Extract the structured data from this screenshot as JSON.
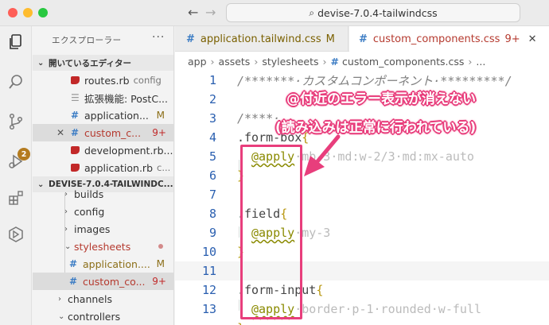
{
  "window": {
    "search_text": "devise-7.0.4-tailwindcss"
  },
  "activity": {
    "scm_badge": "2"
  },
  "sidebar": {
    "title": "エクスプローラー",
    "more": "···",
    "open_editors_label": "開いているエディター",
    "open_editors": [
      {
        "name": "routes.rb",
        "detail": "config",
        "icon": "ruby"
      },
      {
        "name": "拡張機能: PostC...",
        "detail": "",
        "icon": "doc"
      },
      {
        "name": "application...",
        "status": "M",
        "icon": "css"
      },
      {
        "name": "custom_c...",
        "status": "9+",
        "icon": "css",
        "close": "✕"
      },
      {
        "name": "development.rb...",
        "detail": "",
        "icon": "ruby"
      },
      {
        "name": "application.rb",
        "detail": "c...",
        "icon": "ruby"
      }
    ],
    "project_label": "DEVISE-7.0.4-TAILWINDC...",
    "tree": [
      {
        "name": "builds"
      },
      {
        "name": "config"
      },
      {
        "name": "images"
      },
      {
        "name": "stylesheets"
      },
      {
        "name": "application....",
        "status": "M"
      },
      {
        "name": "custom_co...",
        "status": "9+"
      },
      {
        "name": "channels"
      },
      {
        "name": "controllers"
      }
    ]
  },
  "tabs": [
    {
      "label": "application.tailwind.css",
      "status": "M"
    },
    {
      "label": "custom_components.css",
      "status": "9+",
      "close": "✕"
    }
  ],
  "breadcrumb": {
    "parts": [
      "app",
      "assets",
      "stylesheets",
      "custom_components.css",
      "..."
    ],
    "sep": "›"
  },
  "code": {
    "line_numbers": [
      "1",
      "2",
      "3",
      "4",
      "5",
      "6",
      "7",
      "8",
      "9",
      "10",
      "11",
      "12",
      "13"
    ],
    "l1": "/*******·カスタムコンポーネント·*********/",
    "l3": "/****·",
    "l4_sel": ".form-box",
    "l4_br": "{",
    "l5_at": "@apply",
    "l5_rest": "·mb-3·md:w-2/3·md:mx-auto",
    "l6": "}",
    "l8_sel": ".field",
    "l8_br": "{",
    "l9_at": "@apply",
    "l9_rest": "·my-3",
    "l10": "}",
    "l12_sel": ".form-input",
    "l12_br": "{",
    "l13_at": "@apply",
    "l13_rest": "·border·p-1·rounded·w-full",
    "l14": "}"
  },
  "annotation": {
    "line1": "@付近のエラー表示が消えない",
    "line2": "(読み込みは正常に行われている)",
    "color": "#e83e7c"
  }
}
